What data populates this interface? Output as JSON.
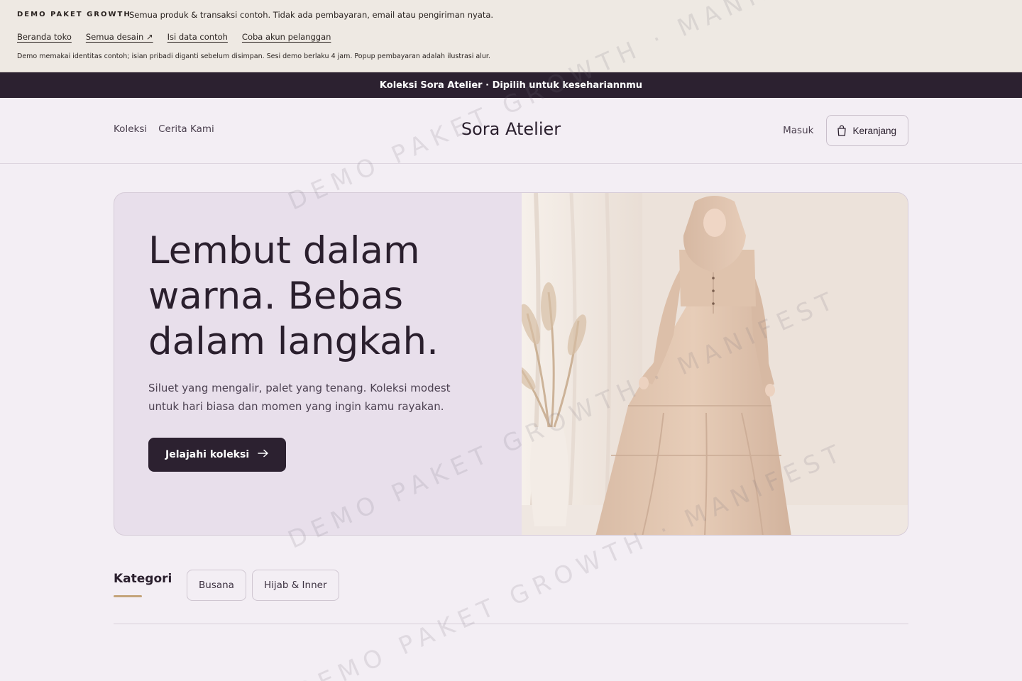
{
  "demo": {
    "tag": "DEMO PAKET GROWTH",
    "description": "Semua produk & transaksi contoh. Tidak ada pembayaran, email atau pengiriman nyata.",
    "links": [
      "Beranda toko",
      "Semua desain ↗",
      "Isi data contoh",
      "Coba akun pelanggan"
    ],
    "note": "Demo memakai identitas contoh; isian pribadi diganti sebelum disimpan. Sesi demo berlaku 4 jam. Popup pembayaran adalah ilustrasi alur."
  },
  "announcement": "Koleksi Sora Atelier · Dipilih untuk kesehariannmu",
  "header": {
    "nav": [
      "Koleksi",
      "Cerita Kami"
    ],
    "brand": "Sora Atelier",
    "login": "Masuk",
    "cart": "Keranjang"
  },
  "hero": {
    "title": "Lembut dalam warna. Bebas dalam langkah.",
    "subtitle": "Siluet yang mengalir, palet yang tenang. Koleksi modest untuk hari biasa dan momen yang ingin kamu rayakan.",
    "cta": "Jelajahi koleksi"
  },
  "categories": {
    "title": "Kategori",
    "items": [
      "Busana",
      "Hijab & Inner"
    ]
  },
  "watermark": "DEMO PAKET GROWTH · MANIFEST",
  "colors": {
    "page_bg": "#f3eef4",
    "demo_bg": "#eee9e3",
    "dark": "#2c2130",
    "hero_panel": "#e8dfeb",
    "accent": "#c4a47a"
  }
}
